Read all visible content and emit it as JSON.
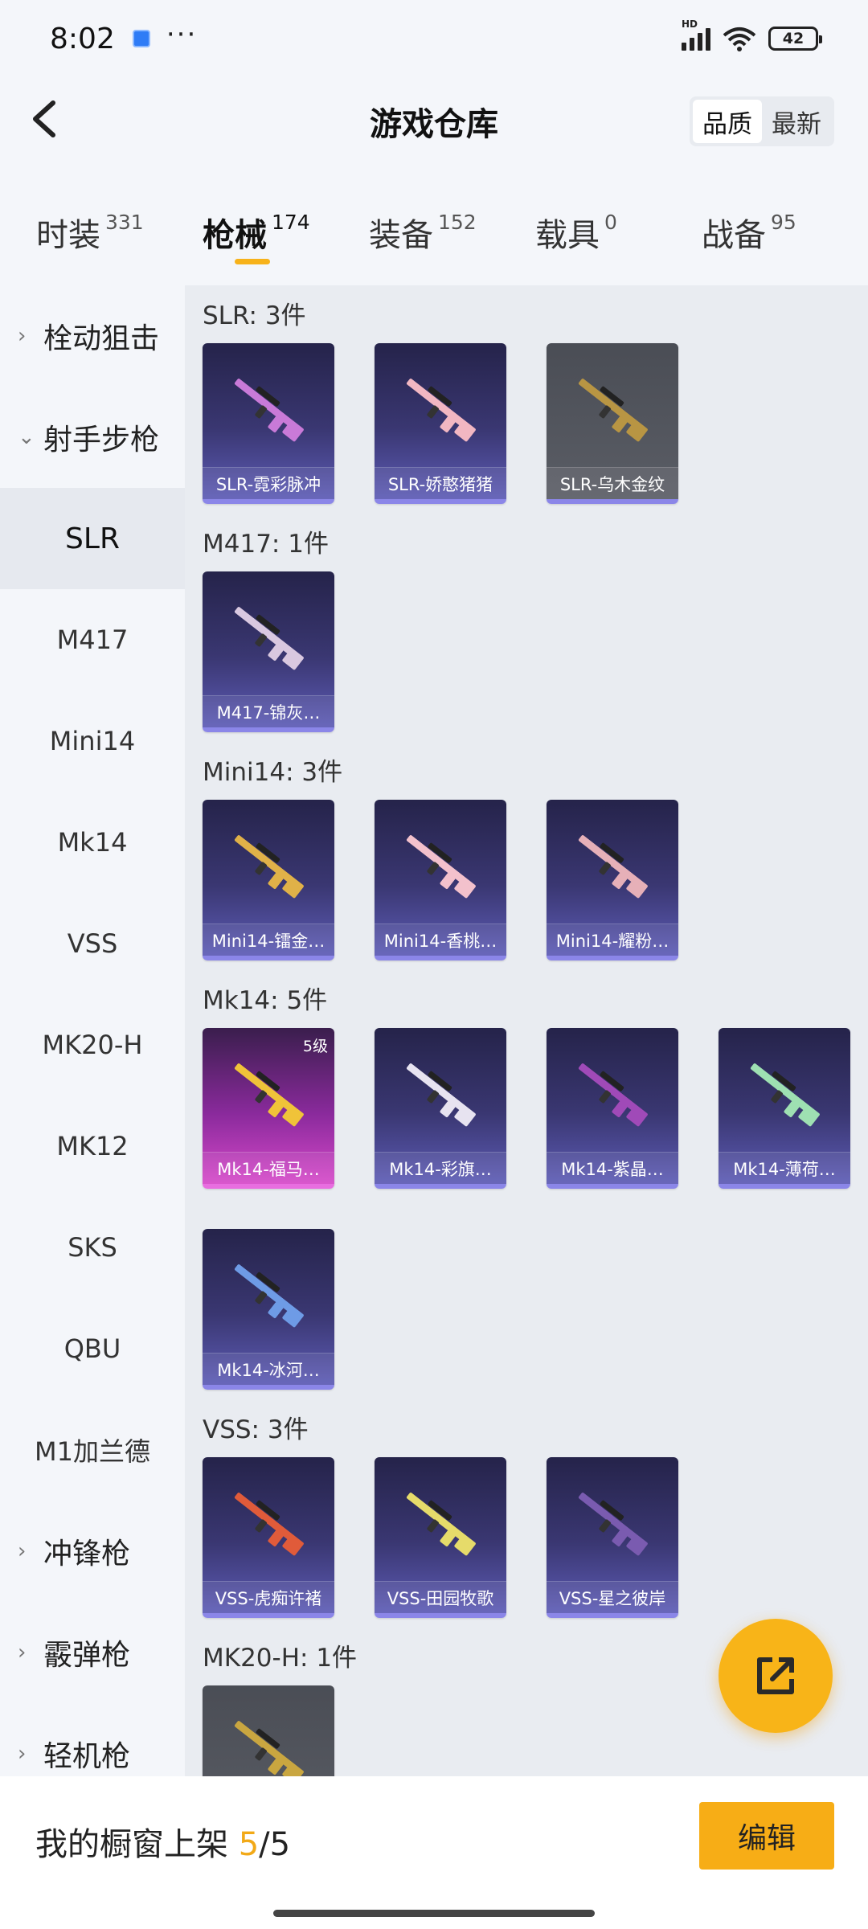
{
  "status": {
    "time": "8:02",
    "battery": "42",
    "network": "HD"
  },
  "header": {
    "title": "游戏仓库",
    "sort_quality": "品质",
    "sort_latest": "最新"
  },
  "tabs": [
    {
      "label": "时装",
      "count": "331"
    },
    {
      "label": "枪械",
      "count": "174"
    },
    {
      "label": "装备",
      "count": "152"
    },
    {
      "label": "载具",
      "count": "0"
    },
    {
      "label": "战备",
      "count": "95"
    }
  ],
  "sidebar": {
    "items": [
      {
        "label": "栓动狙击",
        "type": "category",
        "chevron": "›"
      },
      {
        "label": "射手步枪",
        "type": "category",
        "chevron": "⌄"
      },
      {
        "label": "SLR",
        "type": "sub"
      },
      {
        "label": "M417",
        "type": "sub"
      },
      {
        "label": "Mini14",
        "type": "sub"
      },
      {
        "label": "Mk14",
        "type": "sub"
      },
      {
        "label": "VSS",
        "type": "sub"
      },
      {
        "label": "MK20-H",
        "type": "sub"
      },
      {
        "label": "MK12",
        "type": "sub"
      },
      {
        "label": "SKS",
        "type": "sub"
      },
      {
        "label": "QBU",
        "type": "sub"
      },
      {
        "label": "M1加兰德",
        "type": "sub"
      },
      {
        "label": "冲锋枪",
        "type": "category",
        "chevron": "›"
      },
      {
        "label": "霰弹枪",
        "type": "category",
        "chevron": "›"
      },
      {
        "label": "轻机枪",
        "type": "category",
        "chevron": "›"
      }
    ]
  },
  "groups": [
    {
      "title": "SLR: 3件",
      "items": [
        {
          "label": "SLR-霓彩脉冲",
          "style": "purple",
          "gun": "#c97ad8"
        },
        {
          "label": "SLR-娇憨猪猪",
          "style": "purple",
          "gun": "#f2b7c2"
        },
        {
          "label": "SLR-乌木金纹",
          "style": "gray",
          "gun": "#b89543"
        }
      ]
    },
    {
      "title": "M417: 1件",
      "items": [
        {
          "label": "M417-锦灰…",
          "style": "purple",
          "gun": "#d9c8e0"
        }
      ]
    },
    {
      "title": "Mini14: 3件",
      "items": [
        {
          "label": "Mini14-镭金…",
          "style": "purple",
          "gun": "#e0b148"
        },
        {
          "label": "Mini14-香桃…",
          "style": "purple",
          "gun": "#f3c1cc"
        },
        {
          "label": "Mini14-耀粉…",
          "style": "purple",
          "gun": "#e6b0b8"
        }
      ]
    },
    {
      "title": "Mk14: 5件",
      "items": [
        {
          "label": "Mk14-福马…",
          "style": "pink",
          "gun": "#f0c339",
          "level": "5级"
        },
        {
          "label": "Mk14-彩旗…",
          "style": "purple",
          "gun": "#e7e3f0"
        },
        {
          "label": "Mk14-紫晶…",
          "style": "purple",
          "gun": "#a04ab8"
        },
        {
          "label": "Mk14-薄荷…",
          "style": "purple",
          "gun": "#9ee0b2"
        },
        {
          "label": "Mk14-冰河…",
          "style": "purple",
          "gun": "#6e9be6"
        }
      ]
    },
    {
      "title": "VSS: 3件",
      "items": [
        {
          "label": "VSS-虎痴许褚",
          "style": "purple",
          "gun": "#e05b3a"
        },
        {
          "label": "VSS-田园牧歌",
          "style": "purple",
          "gun": "#e6db6a"
        },
        {
          "label": "VSS-星之彼岸",
          "style": "purple",
          "gun": "#7a5bb0"
        }
      ]
    },
    {
      "title": "MK20-H: 1件",
      "items": [
        {
          "label": "",
          "style": "gray",
          "gun": "#c9a640"
        }
      ]
    }
  ],
  "bottom": {
    "prefix": "我的橱窗上架 ",
    "current": "5",
    "total": "/5",
    "edit": "编辑"
  },
  "colors": {
    "accent": "#f7ad16",
    "tab_underline": "#f7b21a",
    "card_border": "#8b86e8"
  }
}
